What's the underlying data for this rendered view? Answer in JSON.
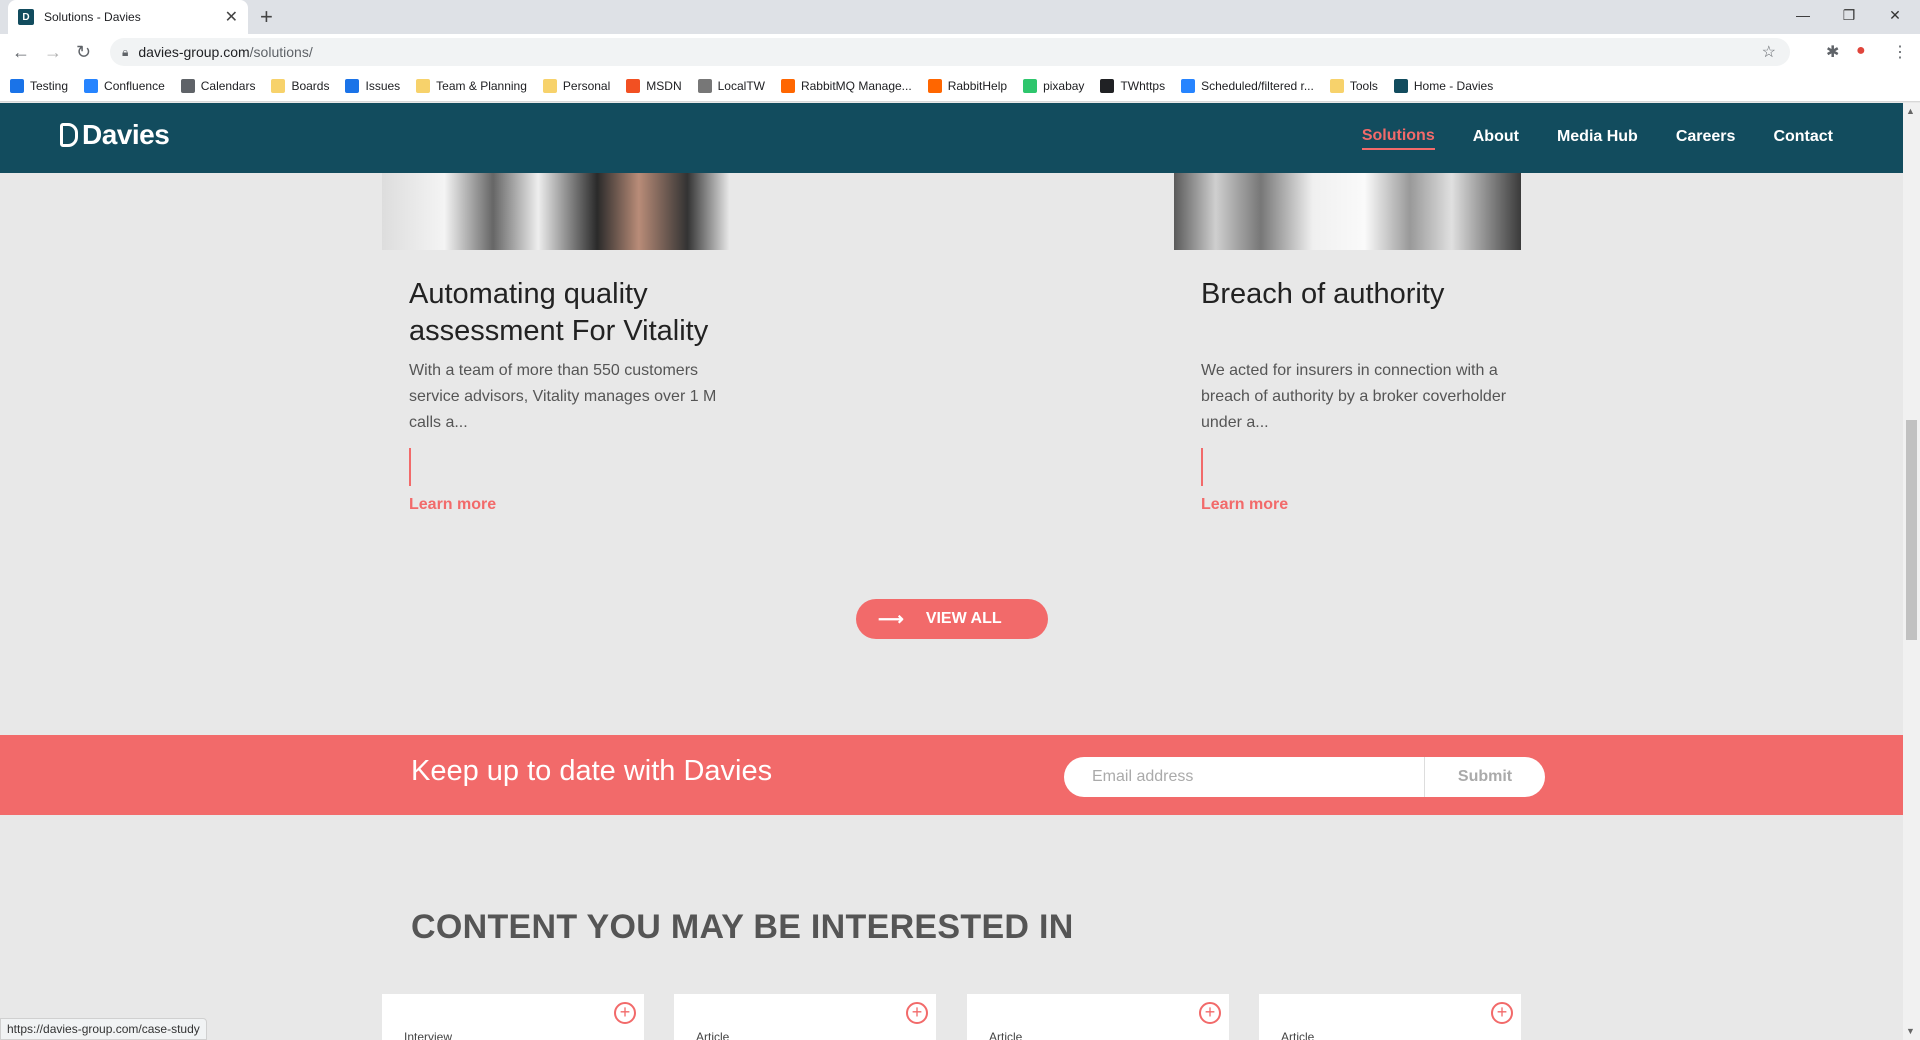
{
  "browser": {
    "tab_title": "Solutions - Davies",
    "url_host": "davies-group.com",
    "url_path": "/solutions/",
    "status_url": "https://davies-group.com/case-study",
    "bookmarks": [
      {
        "label": "Testing",
        "color": "#1a73e8"
      },
      {
        "label": "Confluence",
        "color": "#2684ff"
      },
      {
        "label": "Calendars",
        "color": "#5f6368"
      },
      {
        "label": "Boards",
        "color": "#f7d26b"
      },
      {
        "label": "Issues",
        "color": "#1a73e8"
      },
      {
        "label": "Team & Planning",
        "color": "#f7d26b"
      },
      {
        "label": "Personal",
        "color": "#f7d26b"
      },
      {
        "label": "MSDN",
        "color": "#f25022"
      },
      {
        "label": "LocalTW",
        "color": "#777777"
      },
      {
        "label": "RabbitMQ Manage...",
        "color": "#ff6600"
      },
      {
        "label": "RabbitHelp",
        "color": "#ff6600"
      },
      {
        "label": "pixabay",
        "color": "#2ec66d"
      },
      {
        "label": "TWhttps",
        "color": "#202124"
      },
      {
        "label": "Scheduled/filtered r...",
        "color": "#2684ff"
      },
      {
        "label": "Tools",
        "color": "#f7d26b"
      },
      {
        "label": "Home - Davies",
        "color": "#124c5e"
      }
    ]
  },
  "site": {
    "logo": "Davies",
    "nav": [
      "Solutions",
      "About",
      "Media Hub",
      "Careers",
      "Contact"
    ]
  },
  "case_studies": [
    {
      "title": "Automating quality assessment For Vitality",
      "description": "With a team of more than 550 customers service advisors, Vitality manages over 1 M calls a...",
      "link": "Learn more"
    },
    {
      "title": "Breach of authority",
      "description": "We acted for insurers in connection with a breach of authority by a broker coverholder under a...",
      "link": "Learn more"
    }
  ],
  "view_all": "VIEW ALL",
  "newsletter": {
    "heading": "Keep up to date with Davies",
    "placeholder": "Email address",
    "submit": "Submit"
  },
  "content": {
    "heading": "CONTENT YOU MAY BE INTERESTED IN",
    "cards": [
      {
        "type": "Interview"
      },
      {
        "type": "Article"
      },
      {
        "type": "Article"
      },
      {
        "type": "Article"
      }
    ]
  },
  "colors": {
    "brand_teal": "#124c5e",
    "accent_coral": "#f26a6a"
  }
}
